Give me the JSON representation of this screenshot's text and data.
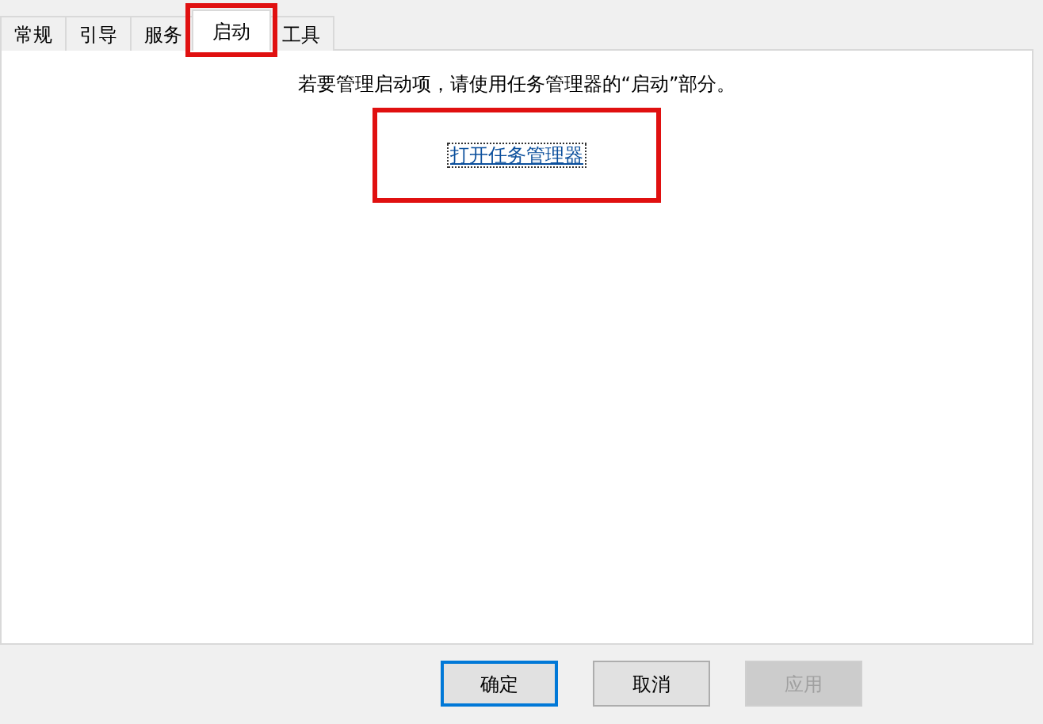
{
  "tabs": [
    {
      "label": "常规",
      "selected": false,
      "highlighted": false
    },
    {
      "label": "引导",
      "selected": false,
      "highlighted": false
    },
    {
      "label": "服务",
      "selected": false,
      "highlighted": false
    },
    {
      "label": "启动",
      "selected": true,
      "highlighted": true
    },
    {
      "label": "工具",
      "selected": false,
      "highlighted": false
    }
  ],
  "panel": {
    "message": "若要管理启动项，请使用任务管理器的“启动”部分。",
    "link": {
      "label": "打开任务管理器",
      "highlighted": true
    }
  },
  "buttons": [
    {
      "label": "确定",
      "default": true,
      "disabled": false
    },
    {
      "label": "取消",
      "default": false,
      "disabled": false
    },
    {
      "label": "应用",
      "default": false,
      "disabled": true
    }
  ]
}
